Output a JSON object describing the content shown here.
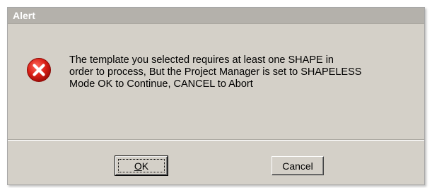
{
  "window": {
    "title": "Alert"
  },
  "icon": {
    "name": "error-icon",
    "color": "#d41a1a"
  },
  "message": {
    "line1": "The template you selected requires at least one SHAPE in",
    "line2": "order to process, But the Project Manager is set to SHAPELESS",
    "line3": "Mode  OK to Continue,  CANCEL to Abort"
  },
  "buttons": {
    "ok_mnemonic": "O",
    "ok_rest": "K",
    "cancel_label": "Cancel"
  }
}
